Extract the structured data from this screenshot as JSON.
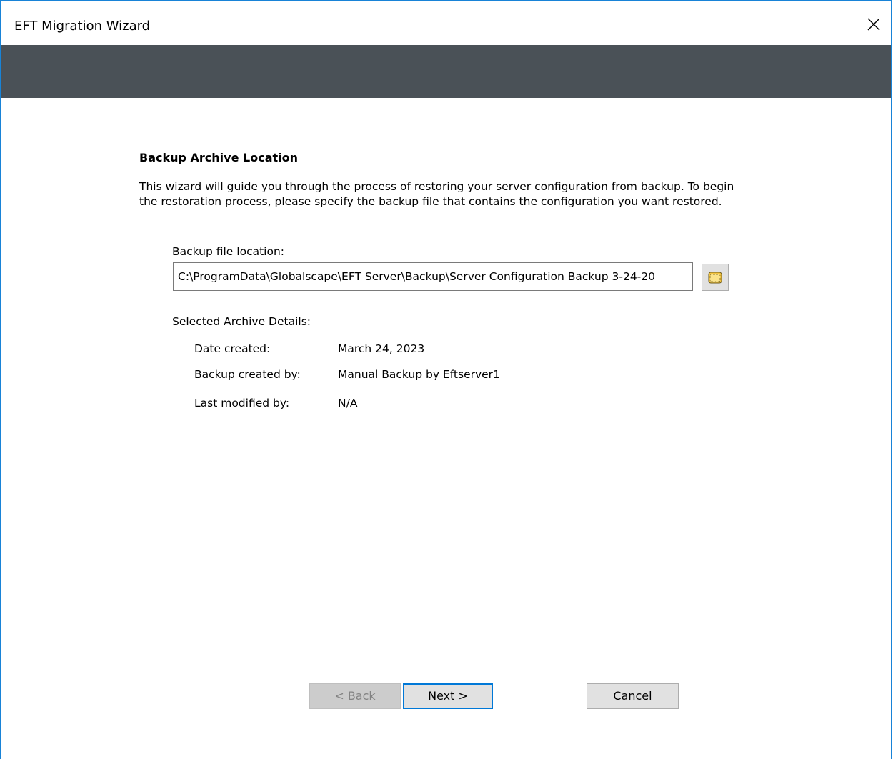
{
  "window": {
    "title": "EFT Migration Wizard",
    "close_glyph": "✕"
  },
  "page": {
    "heading": "Backup Archive Location",
    "intro": "This wizard will guide you through the process of restoring your server configuration from backup. To begin the restoration process, please specify the backup file that contains the configuration you want restored."
  },
  "file": {
    "label": "Backup file location:",
    "value": "C:\\ProgramData\\Globalscape\\EFT Server\\Backup\\Server Configuration Backup 3-24-20",
    "browse_icon": "folder-icon"
  },
  "details": {
    "label": "Selected Archive Details:",
    "rows": [
      {
        "key": "Date created:",
        "value": "March 24, 2023"
      },
      {
        "key": "Backup created by:",
        "value": "Manual Backup by Eftserver1"
      },
      {
        "key": "Last modified by:",
        "value": "N/A"
      }
    ]
  },
  "buttons": {
    "back": "< Back",
    "next": "Next >",
    "cancel": "Cancel"
  },
  "colors": {
    "banner": "#4a5157",
    "window_border": "#1883d7",
    "default_button_border": "#0078d7"
  }
}
